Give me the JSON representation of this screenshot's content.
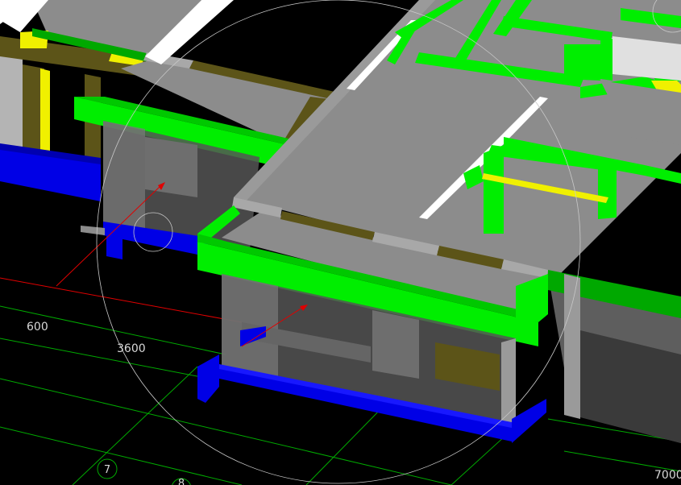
{
  "viewport": {
    "background": "#000000",
    "colors": {
      "slab": "#8c8c8c",
      "slab_dark": "#6e6e6e",
      "slab_light": "#a8a8a8",
      "beam_green": "#00ee00",
      "beam_green_dark": "#00a800",
      "beam_olive": "#5c5418",
      "beam_yellow": "#f0f000",
      "foundation_blue": "#0000e6",
      "wall_gray": "#b4b4b4",
      "wall_white": "#ffffff",
      "grid_green": "#00aa00",
      "axis_red": "#e00000",
      "orbit_circle": "#c8c8c8",
      "label_text": "#d8d8d8"
    }
  },
  "dimensions": {
    "d1": "600",
    "d2": "3600",
    "d3": "7000"
  },
  "axis_labels": {
    "a1": "7",
    "a2": "8"
  },
  "icons": {
    "orbit": "orbit-circle-icon",
    "pivot": "pivot-target-icon",
    "arrow1": "red-arrow-icon",
    "arrow2": "red-arrow-icon"
  }
}
